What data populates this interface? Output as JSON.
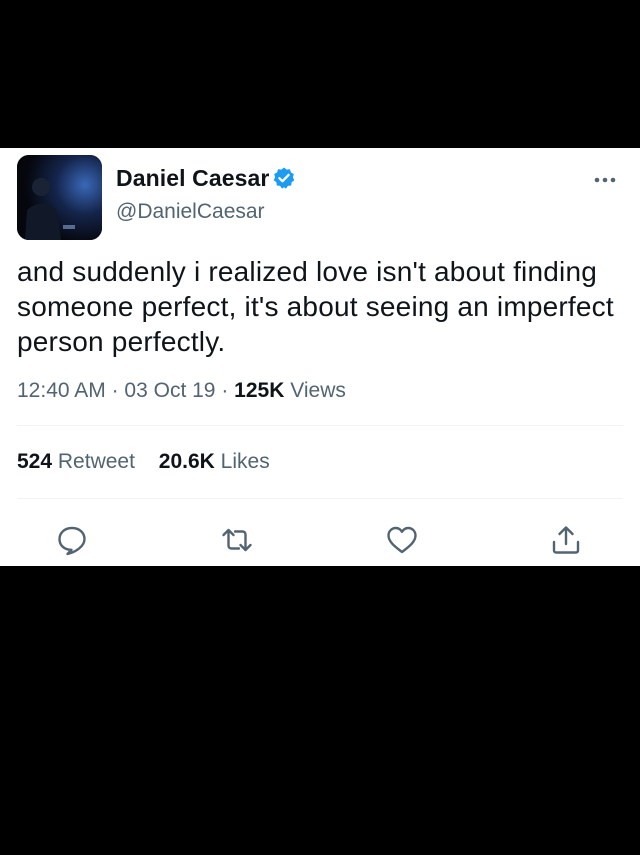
{
  "tweet": {
    "author": {
      "display_name": "Daniel Caesar",
      "handle": "@DanielCaesar",
      "verified": true
    },
    "text": "and suddenly i realized love isn't about finding someone perfect, it's about seeing an imperfect person perfectly.",
    "time": "12:40 AM",
    "separator": "·",
    "date": "03 Oct 19",
    "views_count": "125K",
    "views_label": "Views",
    "retweets_count": "524",
    "retweets_label": "Retweet",
    "likes_count": "20.6K",
    "likes_label": "Likes"
  },
  "icons": {
    "more": "more-horizontal-icon",
    "verified": "verified-badge-icon",
    "reply": "reply-icon",
    "retweet": "retweet-icon",
    "like": "heart-icon",
    "share": "share-icon"
  },
  "colors": {
    "verified_blue": "#1d9bf0",
    "text_primary": "#0f1419",
    "text_secondary": "#536471",
    "icon_gray": "#536471",
    "divider": "#eff3f4",
    "background_outer": "#000000",
    "card_background": "#ffffff"
  }
}
